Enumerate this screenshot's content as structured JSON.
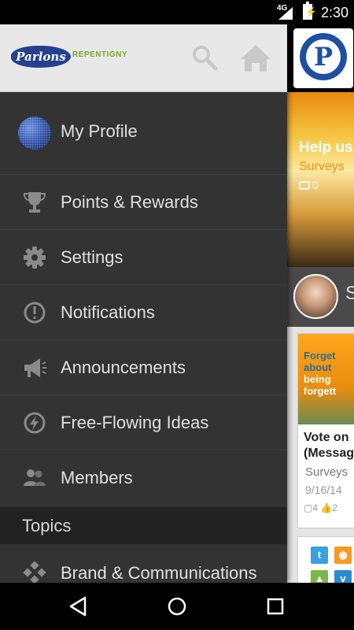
{
  "status_bar": {
    "network": "4G",
    "time": "2:30"
  },
  "header": {
    "brand_name": "Parlons",
    "brand_sub": "REPENTIGNY",
    "search_icon": "search-icon",
    "home_icon": "home-icon"
  },
  "drawer": {
    "items": [
      {
        "label": "My Profile",
        "icon": "avatar"
      },
      {
        "label": "Points & Rewards",
        "icon": "trophy-icon"
      },
      {
        "label": "Settings",
        "icon": "gear-icon"
      },
      {
        "label": "Notifications",
        "icon": "exclamation-circle-icon"
      },
      {
        "label": "Announcements",
        "icon": "megaphone-icon"
      },
      {
        "label": "Free-Flowing Ideas",
        "icon": "lightning-circle-icon"
      },
      {
        "label": "Members",
        "icon": "members-icon"
      }
    ],
    "topics_header": "Topics",
    "topics": [
      {
        "label": "Brand & Communications",
        "icon": "diamond-grid-icon"
      }
    ]
  },
  "main": {
    "app_logo_letter": "P",
    "hero": {
      "title": "Help us",
      "category": "Surveys",
      "comment_count": "0"
    },
    "user_initial": "S",
    "card": {
      "image_text_line1": "Forget",
      "image_text_line2": "about",
      "image_text_line3": "being",
      "image_text_line4": "forgett",
      "title_line1": "Vote on",
      "title_line2": "(Messag",
      "category": "Surveys",
      "date": "9/16/14",
      "comments": "4",
      "likes": "2"
    }
  },
  "nav": {
    "back_icon": "back-icon",
    "home_icon": "home-circle-icon",
    "recents_icon": "recents-icon"
  }
}
